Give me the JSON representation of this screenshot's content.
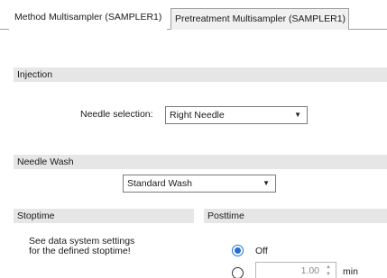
{
  "tabs": [
    {
      "label": "Method Multisampler (SAMPLER1)",
      "active": true
    },
    {
      "label": "Pretreatment Multisampler (SAMPLER1)",
      "active": false
    }
  ],
  "injection": {
    "header": "Injection",
    "needle_selection_label": "Needle selection:",
    "needle_selection_value": "Right Needle"
  },
  "needle_wash": {
    "header": "Needle Wash",
    "value": "Standard Wash"
  },
  "stoptime": {
    "header": "Stoptime",
    "note_line1": "See data system settings",
    "note_line2": "for the defined stoptime!"
  },
  "posttime": {
    "header": "Posttime",
    "off_label": "Off",
    "value": "1.00",
    "unit": "min",
    "selected": "off"
  },
  "icons": {
    "dropdown": "chevron-down-icon",
    "spinner": "up-down-spinner-icon"
  },
  "colors": {
    "section_header_bg": "#e6e6e6",
    "radio_selected": "#1e6fd9"
  }
}
